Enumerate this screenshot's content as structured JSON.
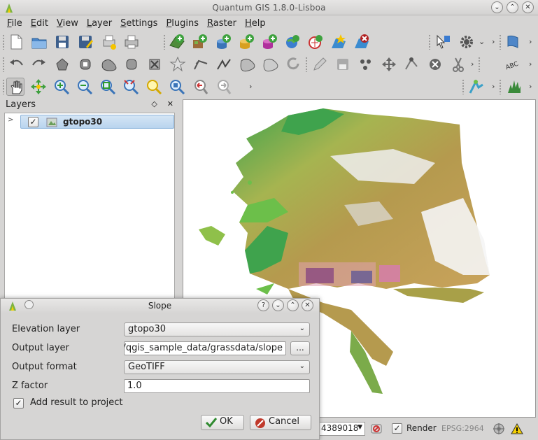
{
  "window": {
    "title": "Quantum GIS 1.8.0-Lisboa",
    "controls": [
      "⌄",
      "⌃",
      "✕"
    ]
  },
  "menu": [
    "File",
    "Edit",
    "View",
    "Layer",
    "Settings",
    "Plugins",
    "Raster",
    "Help"
  ],
  "toolbar_overflow": "›",
  "layers_panel": {
    "title": "Layers",
    "controls": [
      "◇",
      "✕"
    ],
    "layers": [
      {
        "name": "gtopo30",
        "checked": "✓",
        "expander": ">"
      }
    ]
  },
  "dialog": {
    "title": "Slope",
    "title_controls": [
      "?",
      "⌄",
      "⌃",
      "✕"
    ],
    "fields": {
      "elevation_label": "Elevation layer",
      "elevation_value": "gtopo30",
      "output_layer_label": "Output layer",
      "output_layer_value": "/qgis_sample_data/grassdata/slope",
      "browse_label": "...",
      "output_format_label": "Output format",
      "output_format_value": "GeoTIFF",
      "z_factor_label": "Z factor",
      "z_factor_value": "1.0"
    },
    "add_result": {
      "checked": "✓",
      "label": "Add result to project"
    },
    "ok_label": "OK",
    "cancel_label": "Cancel"
  },
  "status_bar": {
    "scale": "4389018",
    "render_checked": "✓",
    "render_label": "Render",
    "crs": "EPSG:2964"
  },
  "colors": {
    "selection": "#b9d4ee",
    "lowland_green": "#3fa34d",
    "midland_tan": "#b59a4e",
    "highland_white": "#f5f5f5",
    "ok_green": "#2f8a2f",
    "cancel_red": "#c0392b"
  }
}
